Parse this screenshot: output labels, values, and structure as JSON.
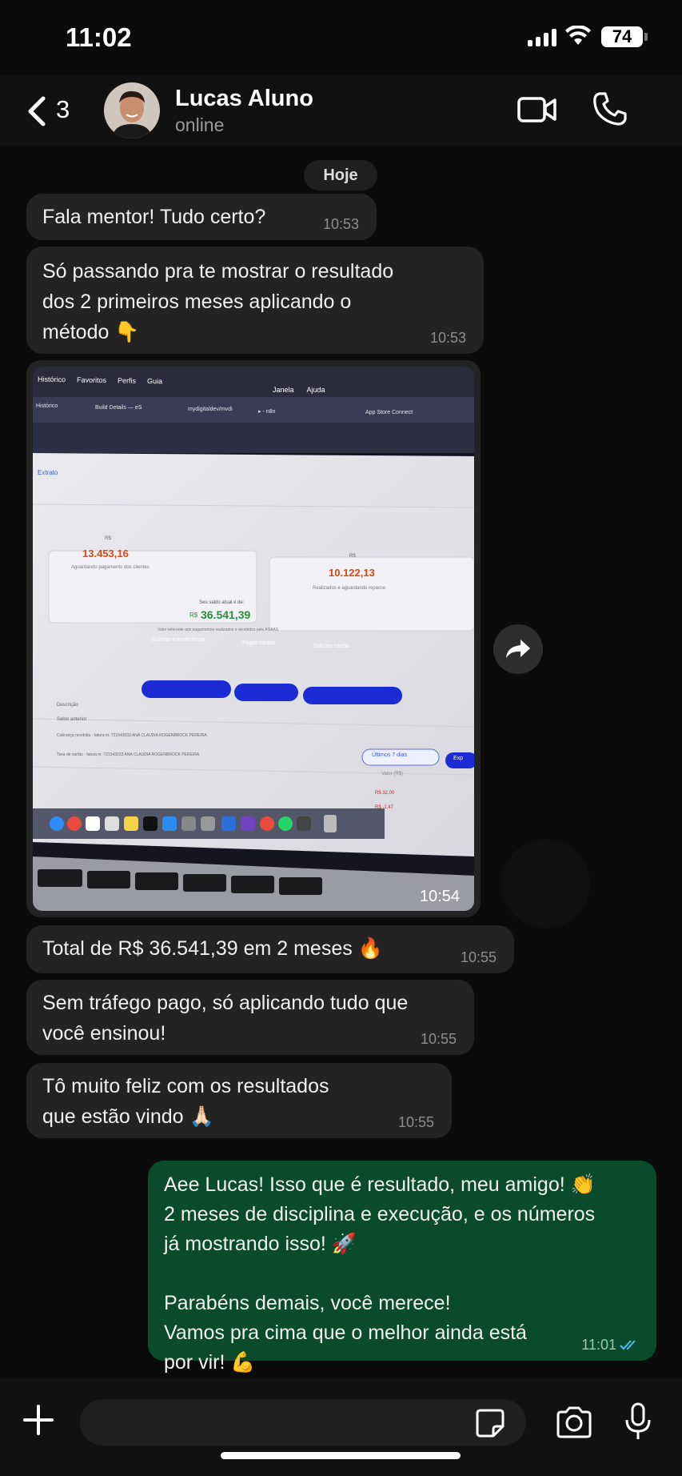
{
  "status_bar": {
    "time": "11:02",
    "battery": "74"
  },
  "header": {
    "back_count": "3",
    "contact_name": "Lucas Aluno",
    "contact_status": "online"
  },
  "date_pill": "Hoje",
  "messages": [
    {
      "text": "Fala mentor! Tudo certo?",
      "time": "10:53"
    },
    {
      "text": "Só passando pra te mostrar o resultado\ndos 2 primeiros meses aplicando o\nmétodo 👇",
      "time": "10:53"
    },
    {
      "image_time": "10:54"
    },
    {
      "text": "Total de R$ 36.541,39 em 2 meses 🔥",
      "time": "10:55"
    },
    {
      "text": "Sem tráfego pago, só aplicando tudo que\nvocê ensinou!",
      "time": "10:55"
    },
    {
      "text": "Tô muito feliz com os resultados\nque estão vindo 🙏🏻",
      "time": "10:55"
    },
    {
      "text": "Aee Lucas! Isso que é resultado, meu amigo! 👏\n2 meses de disciplina e execução, e os números\njá mostrando isso! 🚀\n\nParabéns demais, você merece!\nVamos pra cima que o melhor ainda está\npor vir! 💪",
      "time": "11:01"
    }
  ],
  "photo": {
    "menu": [
      "Histórico",
      "Favoritos",
      "Perfis",
      "Guia"
    ],
    "menu_right": [
      "Janela",
      "Ajuda"
    ],
    "tabs": [
      "Histórico",
      "Build Details — eS",
      "mydigitaldev/mvdi",
      "▸ - n8n",
      "App Store Connect"
    ],
    "extrato": "Extrato",
    "card1_label": "R$",
    "card1_value": "13.453,16",
    "card1_note": "Aguardando pagamento dos clientes",
    "card2_label": "R$",
    "card2_value": "10.122,13",
    "card2_note": "Realizados e aguardando repasse",
    "saldo_label": "Seu saldo atual é de:",
    "saldo_prefix": "R$",
    "saldo_value": "36.541,39",
    "saldo_note": "Valor referente aos pagamentos realizados e recebidos pelo ASAAS",
    "btn1": "Solicitar transferência",
    "btn2": "Pagar contas",
    "btn3": "Solicitar cartão",
    "filter": "Últimos 7 dias",
    "export": "Exp",
    "valor_header": "Valor (R$)",
    "row1": "Descrição",
    "row2": "Saldo anterior",
    "row3": "Cobrança recebida - fatura nr. 721543033 ANA CLAUDIA ROGENBROCK PEREIRA",
    "row4": "Taxa de cartão - fatura nr. 721543033 ANA CLAUDIA ROGENBROCK PEREIRA",
    "amount1": "R$ 32,00",
    "amount2": "R$ -1,47"
  },
  "colors": {
    "background": "#0b0b0b",
    "incoming_bubble": "#232323",
    "outgoing_bubble": "#0a4b2c",
    "read_ticks": "#53bdeb"
  }
}
